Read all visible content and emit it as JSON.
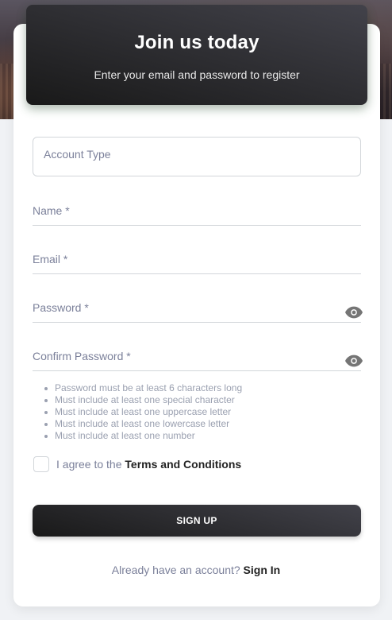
{
  "header": {
    "title": "Join us today",
    "subtitle": "Enter your email and password to register"
  },
  "form": {
    "account_type_label": "Account Type",
    "name_label": "Name *",
    "email_label": "Email *",
    "password_label": "Password *",
    "confirm_password_label": "Confirm Password *",
    "password_icon": "eye-icon",
    "confirm_password_icon": "eye-icon"
  },
  "password_hints": [
    "Password must be at least 6 characters long",
    "Must include at least one special character",
    "Must include at least one uppercase letter",
    "Must include at least one lowercase letter",
    "Must include at least one number"
  ],
  "terms": {
    "prefix": "I agree to the ",
    "link": "Terms and Conditions",
    "checked": false
  },
  "signup_button": "SIGN UP",
  "footer": {
    "prompt": "Already have an account? ",
    "link": "Sign In"
  },
  "colors": {
    "dark_gradient_start": "#42424a",
    "dark_gradient_end": "#191919",
    "label_gray": "#7b809a",
    "page_bg": "#f0f2f5"
  }
}
